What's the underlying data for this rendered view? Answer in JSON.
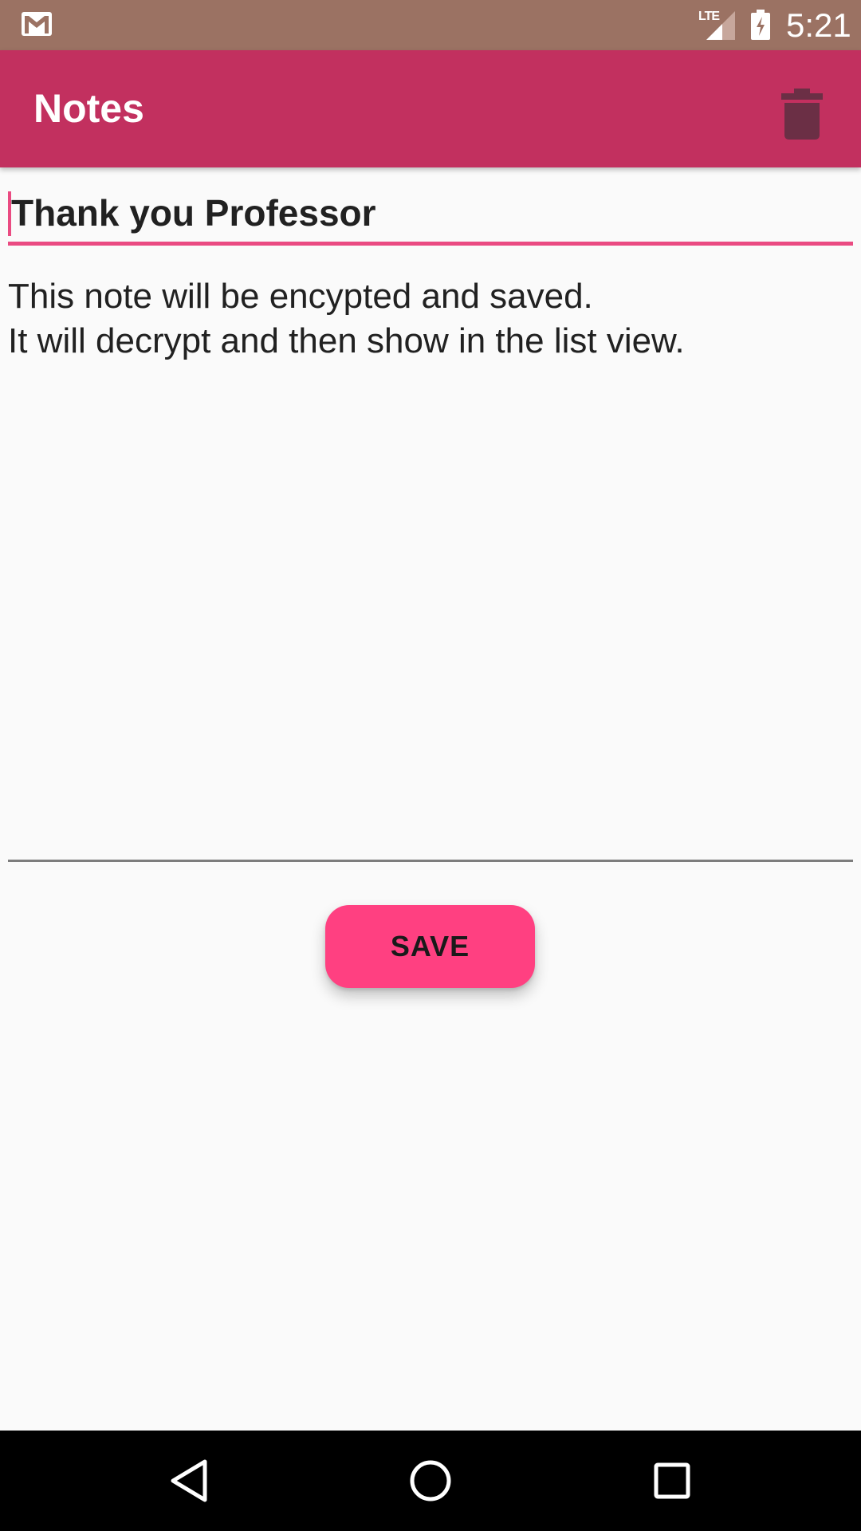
{
  "status_bar": {
    "network_label": "LTE",
    "time": "5:21",
    "icons": [
      "gmail-notification-icon",
      "signal-icon",
      "battery-charging-icon"
    ]
  },
  "app_bar": {
    "title": "Notes",
    "delete_icon": "trash-icon"
  },
  "editor": {
    "title_value": "Thank you Professor",
    "body_value": "This note will be encypted and saved.\nIt will decrypt and then show in the list view."
  },
  "actions": {
    "save_label": "SAVE"
  },
  "nav_bar": {
    "icons": [
      "back-icon",
      "home-icon",
      "recents-icon"
    ]
  },
  "colors": {
    "status_bar": "#9b7263",
    "app_bar": "#c2305f",
    "accent": "#ff4081",
    "underline_active": "#ea4b82",
    "trash_icon": "#6b2f45",
    "background": "#fafafa"
  }
}
